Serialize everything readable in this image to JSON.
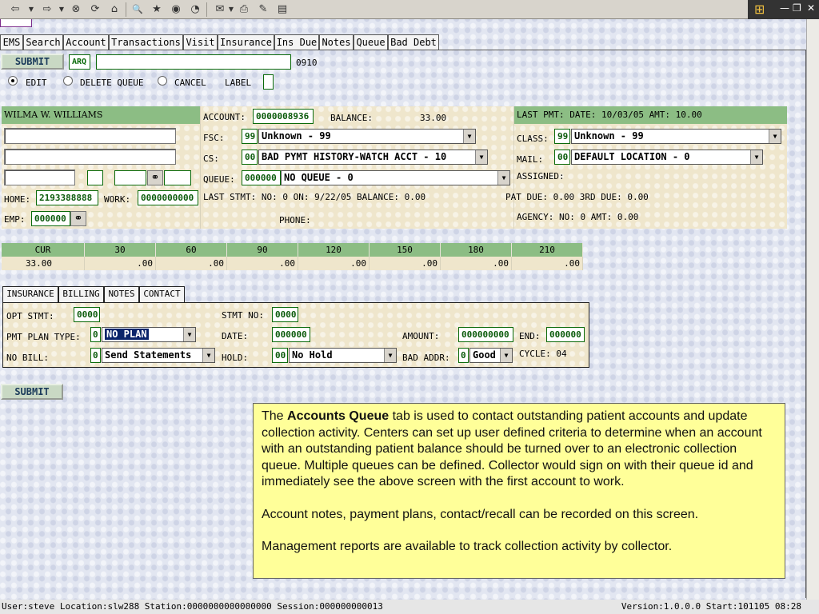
{
  "toolbar": {
    "icons": [
      "back-icon",
      "back-dropdown-icon",
      "forward-icon",
      "forward-dropdown-icon",
      "stop-icon",
      "refresh-icon",
      "home-icon",
      "search-icon",
      "favorites-icon",
      "media-icon",
      "history-icon",
      "mail-icon",
      "print-icon",
      "edit-icon",
      "discuss-icon"
    ],
    "glyphs": {
      "back": "⇦",
      "fwd": "⇨",
      "stop": "⊗",
      "refresh": "⟳",
      "home": "⌂",
      "search": "🔍",
      "fav": "★",
      "media": "◉",
      "history": "◔",
      "mail": "✉",
      "print": "⎙",
      "edit": "✎",
      "discuss": "▤",
      "win": "⊞",
      "min": "—",
      "max": "❐",
      "close": "✕",
      "binoc": "⚭"
    }
  },
  "tabs": [
    "EMS",
    "Search",
    "Account",
    "Transactions",
    "Visit",
    "Insurance",
    "Ins Due",
    "Notes",
    "Queue",
    "Bad Debt"
  ],
  "submit_label": "SUBMIT",
  "arq_label": "ARQ",
  "arq_input": "",
  "queue_code": "0910",
  "mode": {
    "edit": "EDIT",
    "delete": "DELETE QUEUE",
    "cancel": "CANCEL",
    "label": "LABEL"
  },
  "patient": {
    "name": "WILMA W. WILLIAMS",
    "home_label": "HOME:",
    "home_phone": "2193388888",
    "work_label": "WORK:",
    "work_phone": "0000000000",
    "emp_label": "EMP:",
    "emp": "000000"
  },
  "account": {
    "account_label": "ACCOUNT:",
    "account_no": "0000008936",
    "balance_label": "BALANCE:",
    "balance": "33.00",
    "fsc_label": "FSC:",
    "fsc_code": "99",
    "fsc_value": "Unknown - 99",
    "cs_label": "CS:",
    "cs_code": "00",
    "cs_value": "BAD PYMT HISTORY-WATCH ACCT - 10",
    "queue_label": "QUEUE:",
    "queue_code": "000000",
    "queue_value": "NO QUEUE - 0",
    "last_stmt": "LAST STMT: NO:  0 ON:  9/22/05 BALANCE:        0.00",
    "phone_label": "PHONE:"
  },
  "right": {
    "last_pmt": "LAST PMT: DATE: 10/03/05   AMT:       10.00",
    "class_label": "CLASS:",
    "class_code": "99",
    "class_value": "Unknown - 99",
    "mail_label": "MAIL:",
    "mail_code": "00",
    "mail_value": "DEFAULT LOCATION - 0",
    "assigned_label": "ASSIGNED:",
    "pat_due": "PAT DUE:         0.00  3RD DUE:        0.00",
    "agency": "AGENCY: NO:   0 AMT:       0.00"
  },
  "aging": {
    "headers": [
      "CUR",
      "30",
      "60",
      "90",
      "120",
      "150",
      "180",
      "210"
    ],
    "values": [
      "33.00",
      ".00",
      ".00",
      ".00",
      ".00",
      ".00",
      ".00",
      ".00"
    ]
  },
  "subtabs": [
    "INSURANCE",
    "BILLING",
    "NOTES",
    "CONTACT"
  ],
  "billing": {
    "opt_stmt_label": "OPT STMT:",
    "opt_stmt": "0000",
    "stmt_no_label": "STMT NO:",
    "stmt_no": "0000",
    "pmt_plan_label": "PMT PLAN TYPE:",
    "pmt_plan_code": "0",
    "pmt_plan_value": "NO PLAN",
    "date_label": "DATE:",
    "date": "000000",
    "amount_label": "AMOUNT:",
    "amount": "000000000",
    "end_label": "END:",
    "end": "000000",
    "no_bill_label": "NO BILL:",
    "no_bill_code": "0",
    "no_bill_value": "Send Statements",
    "hold_label": "HOLD:",
    "hold_code": "00",
    "hold_value": "No Hold",
    "bad_addr_label": "BAD ADDR:",
    "bad_addr_code": "0",
    "bad_addr_value": "Good",
    "cycle": "CYCLE: 04"
  },
  "note": {
    "p1_pre": "The ",
    "p1_bold": "Accounts Queue",
    "p1_post": " tab is used to contact outstanding patient accounts and update collection activity.  Centers can set up user defined criteria to determine when an account with an outstanding patient balance should be turned over to an electronic collection queue.  Multiple queues can be defined. Collector would sign on with their queue id and immediately see the above screen with the first account to work.",
    "p2": "Account notes, payment plans, contact/recall can be recorded on this screen.",
    "p3": "Management reports are available to track collection activity by collector."
  },
  "status": {
    "left": "User:steve Location:slw288 Station:0000000000000000 Session:000000000013",
    "right": "Version:1.0.0.0  Start:101105 08:28"
  },
  "colors": {
    "header_green": "#8cbd84",
    "field_green": "#0a6a0a",
    "note_yellow": "#ffff99",
    "select_blue": "#0a246a"
  }
}
